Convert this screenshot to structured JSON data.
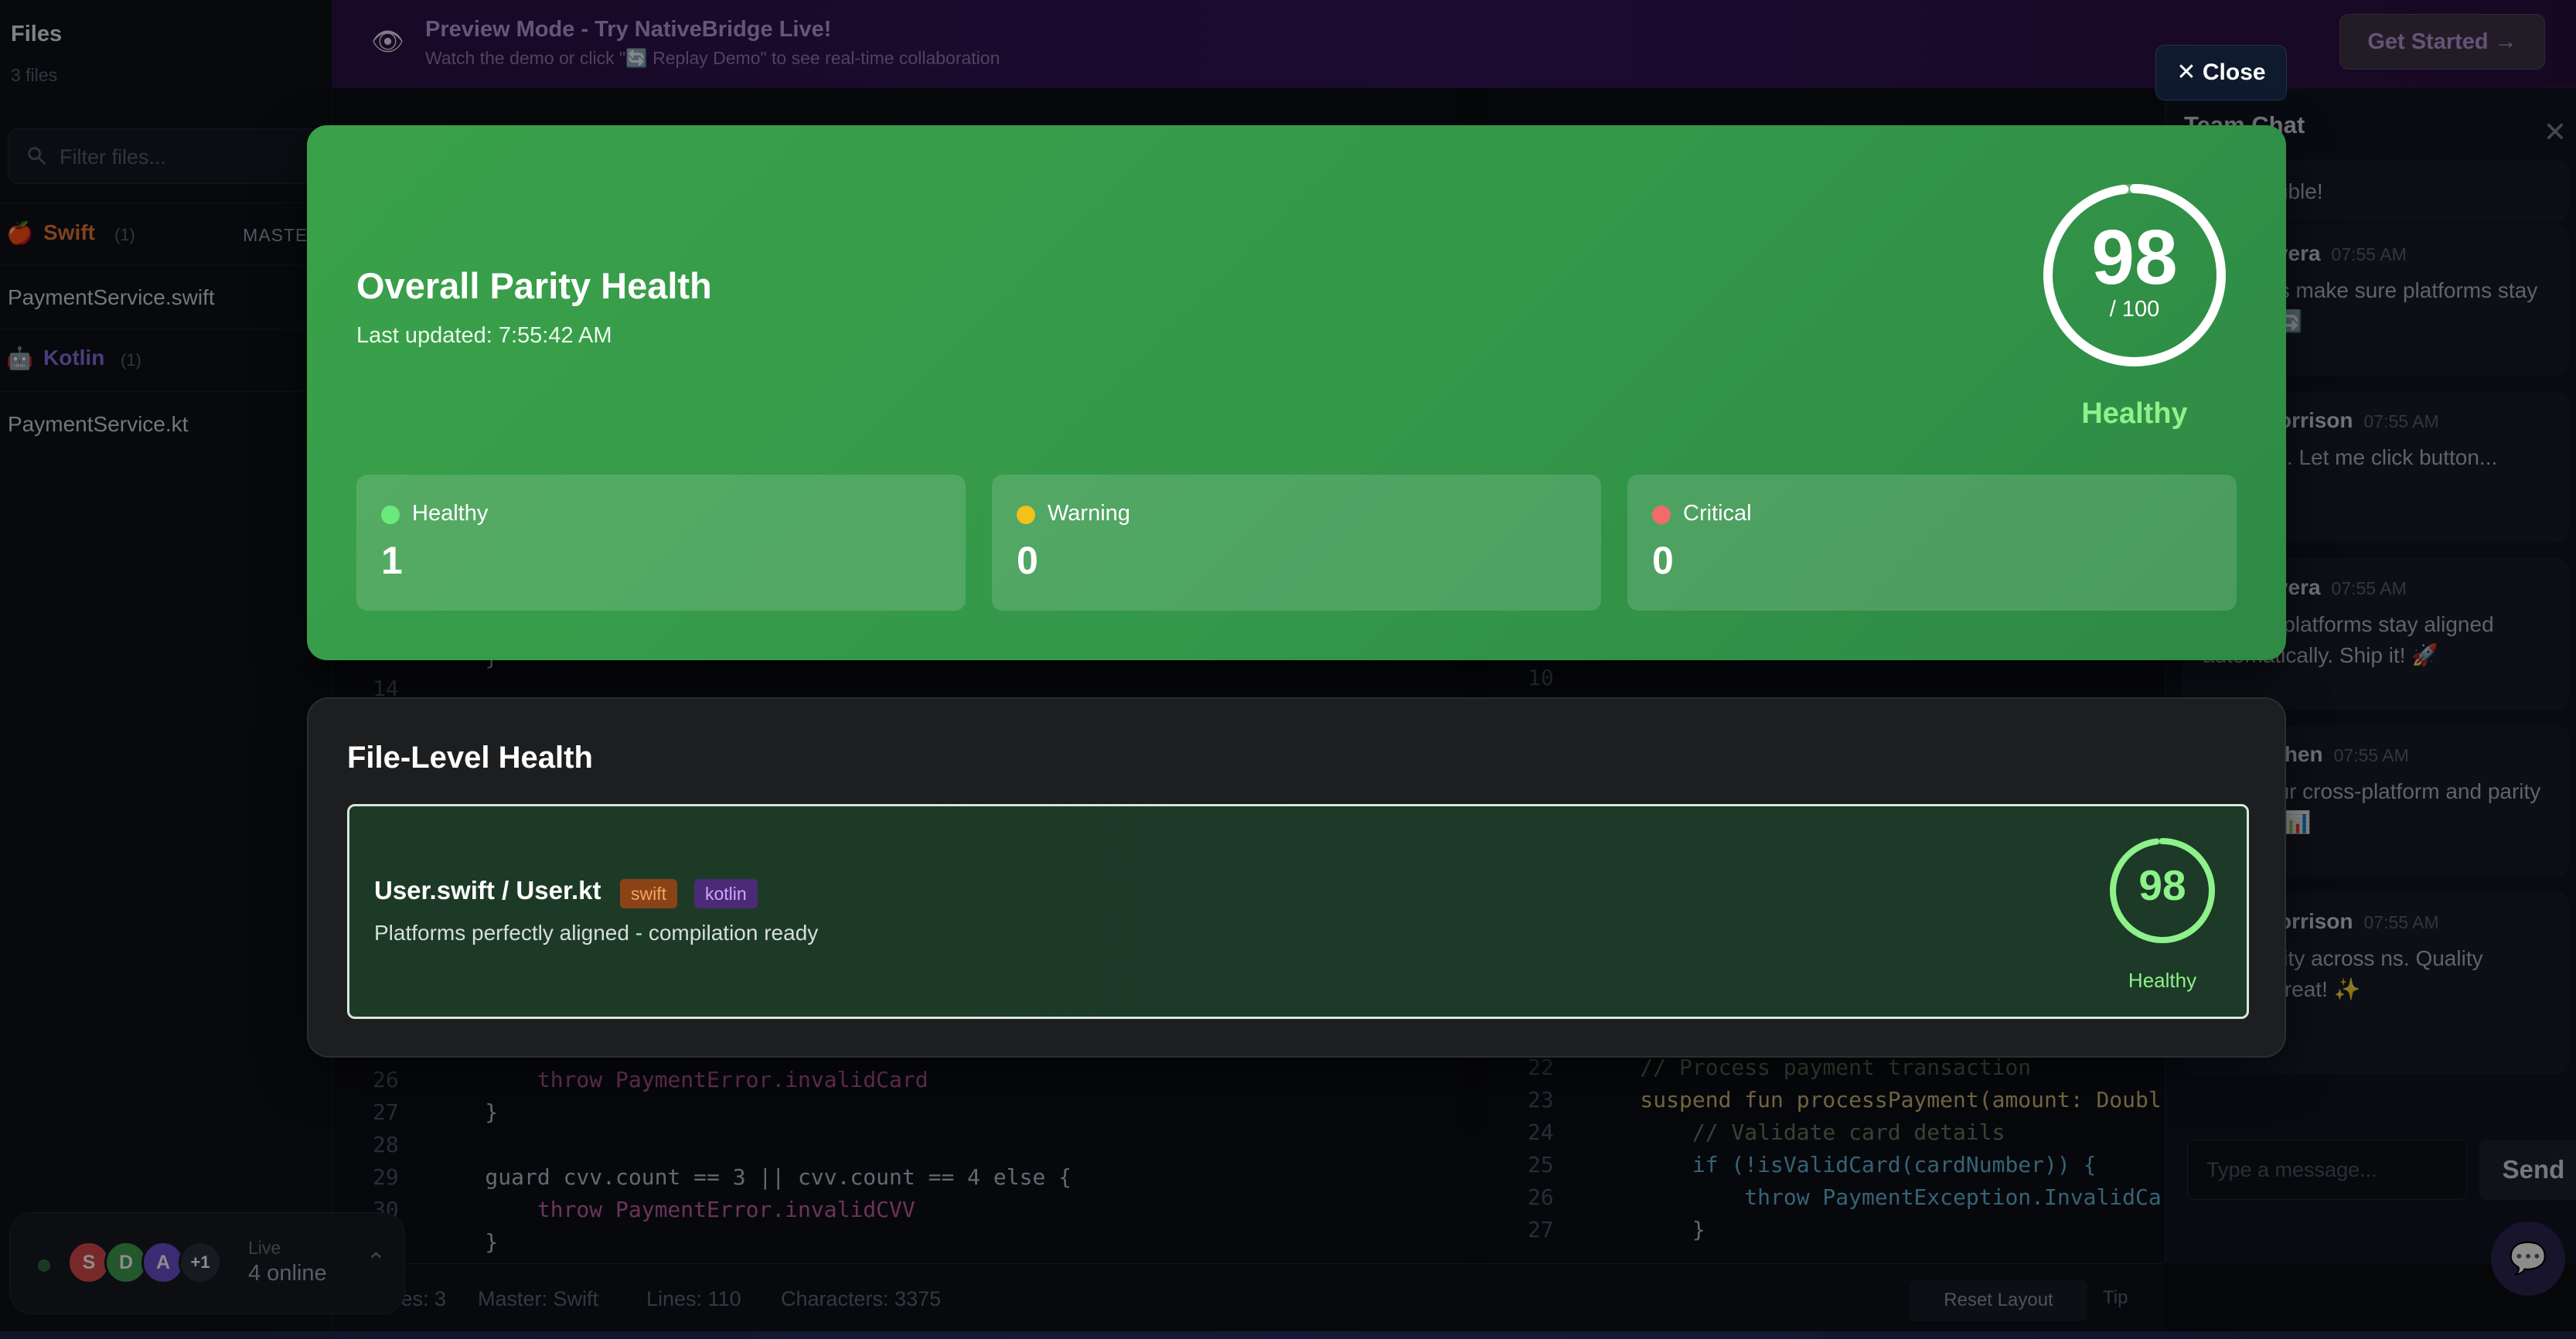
{
  "sidebar": {
    "title": "Files",
    "count": "3 files",
    "filter_placeholder": "Filter files...",
    "groups": [
      {
        "emoji": "🍎",
        "name": "Swift",
        "count": "(1)",
        "badge": "MASTER",
        "color": "#e9793a",
        "file": "PaymentService.swift"
      },
      {
        "emoji": "🤖",
        "name": "Kotlin",
        "count": "(1)",
        "color": "#8b6fe0",
        "file": "PaymentService.kt"
      }
    ]
  },
  "banner": {
    "icon": "👁",
    "title": "Preview Mode - Try NativeBridge Live!",
    "subtitle": "Watch the demo or click \"🔄 Replay Demo\" to see real-time collaboration",
    "cta": "Get Started →"
  },
  "editor_left": {
    "lines": [
      {
        "n": "14",
        "code": "    }"
      },
      {
        "n": "26",
        "code": "        throw PaymentError.invalidCard"
      },
      {
        "n": "27",
        "code": "    }"
      },
      {
        "n": "28",
        "code": ""
      },
      {
        "n": "29",
        "code": "    guard cvv.count == 3 || cvv.count == 4 else {"
      },
      {
        "n": "30",
        "code": "        throw PaymentError.invalidCVV"
      },
      {
        "n": "",
        "code": "    }"
      }
    ]
  },
  "editor_right": {
    "lines": [
      {
        "n": "10",
        "code": ""
      },
      {
        "n": "22",
        "code": "    // Process payment transaction"
      },
      {
        "n": "23",
        "code": "    suspend fun processPayment(amount: Doubl"
      },
      {
        "n": "24",
        "code": "        // Validate card details"
      },
      {
        "n": "25",
        "code": "        if (!isValidCard(cardNumber)) {"
      },
      {
        "n": "26",
        "code": "            throw PaymentException.InvalidCa"
      },
      {
        "n": "27",
        "code": "        }"
      }
    ]
  },
  "chat": {
    "title": "Team Chat",
    "close": "✕",
    "messages": [
      {
        "who": "",
        "time": "",
        "text": "is incredible!"
      },
      {
        "who": "Alex Rivera",
        "time": "07:55 AM",
        "text": "Now let's make sure platforms stay in sync 🔄"
      },
      {
        "who": "Dave Morrison",
        "time": "07:55 AM",
        "text": "drift alert. Let me click button..."
      },
      {
        "who": "Alex Rivera",
        "time": "07:55 AM",
        "text": "nt! Both platforms stay aligned automatically. Ship it! 🚀"
      },
      {
        "who": "Sarah Chen",
        "time": "07:55 AM",
        "text": "check our cross-platform and parity status... 📊"
      },
      {
        "who": "Dave Morrison",
        "time": "07:55 AM",
        "text": "98% parity across ns. Quality scores great! ✨"
      }
    ],
    "input_placeholder": "Type a message...",
    "send": "Send",
    "fab_icon": "💬"
  },
  "statusbar": {
    "files": "Files: 3",
    "master": "Master: Swift",
    "lines": "Lines: 110",
    "chars": "Characters: 3375",
    "reset": "Reset Layout",
    "tip": "Tip"
  },
  "presence": {
    "avatars": [
      {
        "initial": "S",
        "color": "#d94b4b"
      },
      {
        "initial": "D",
        "color": "#3fa04f"
      },
      {
        "initial": "A",
        "color": "#6b4fcf"
      }
    ],
    "more": "+1",
    "label": "Live",
    "online": "4 online"
  },
  "overlay": {
    "close": "Close",
    "overall": {
      "title": "Overall Parity Health",
      "updated": "Last updated: 7:55:42 AM",
      "score": "98",
      "score_of": "/ 100",
      "score_value": 98,
      "status": "Healthy",
      "stats": [
        {
          "label": "Healthy",
          "value": "1",
          "color": "#6bea7b"
        },
        {
          "label": "Warning",
          "value": "0",
          "color": "#f2c11a"
        },
        {
          "label": "Critical",
          "value": "0",
          "color": "#f26b6b"
        }
      ]
    },
    "file_level": {
      "title": "File-Level Health",
      "files": [
        {
          "name": "User.swift / User.kt",
          "tags": [
            "swift",
            "kotlin"
          ],
          "desc": "Platforms perfectly aligned - compilation ready",
          "score": "98",
          "score_value": 98,
          "status": "Healthy"
        }
      ]
    }
  },
  "colors": {
    "accent_green": "#3aa14a",
    "healthy_text": "#8ef18a",
    "swift_tag": "#8a4317",
    "kotlin_tag": "#4b2a77"
  }
}
